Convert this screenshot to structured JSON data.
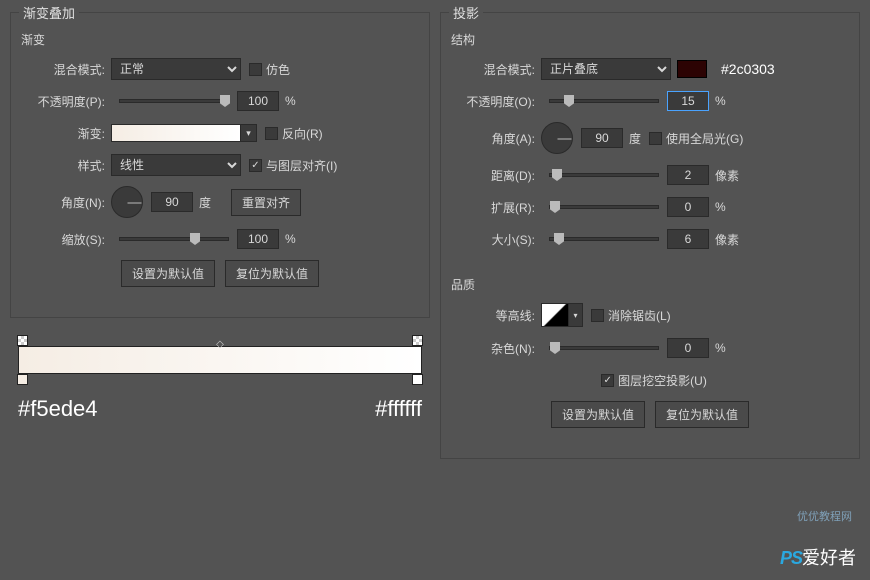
{
  "left": {
    "title": "渐变叠加",
    "section": "渐变",
    "blend_label": "混合模式:",
    "blend_value": "正常",
    "dither_label": "仿色",
    "opacity_label": "不透明度(P):",
    "opacity_value": "100",
    "percent": "%",
    "gradient_label": "渐变:",
    "reverse_label": "反向(R)",
    "style_label": "样式:",
    "style_value": "线性",
    "align_label": "与图层对齐(I)",
    "angle_label": "角度(N):",
    "angle_value": "90",
    "degree": "度",
    "reset_align": "重置对齐",
    "scale_label": "缩放(S):",
    "scale_value": "100",
    "set_default": "设置为默认值",
    "reset_default": "复位为默认值",
    "grad_start": "#f5ede4",
    "grad_end": "#ffffff"
  },
  "right": {
    "title": "投影",
    "structure": "结构",
    "blend_label": "混合模式:",
    "blend_value": "正片叠底",
    "color_hex": "#2c0303",
    "opacity_label": "不透明度(O):",
    "opacity_value": "15",
    "percent": "%",
    "angle_label": "角度(A):",
    "angle_value": "90",
    "degree": "度",
    "global_light": "使用全局光(G)",
    "distance_label": "距离(D):",
    "distance_value": "2",
    "px": "像素",
    "spread_label": "扩展(R):",
    "spread_value": "0",
    "size_label": "大小(S):",
    "size_value": "6",
    "quality": "品质",
    "contour_label": "等高线:",
    "antialias": "消除锯齿(L)",
    "noise_label": "杂色(N):",
    "noise_value": "0",
    "knockout": "图层挖空投影(U)",
    "set_default": "设置为默认值",
    "reset_default": "复位为默认值"
  },
  "watermark": {
    "line1": "优优教程网",
    "brand": "PS",
    "line2": "爱好者"
  }
}
